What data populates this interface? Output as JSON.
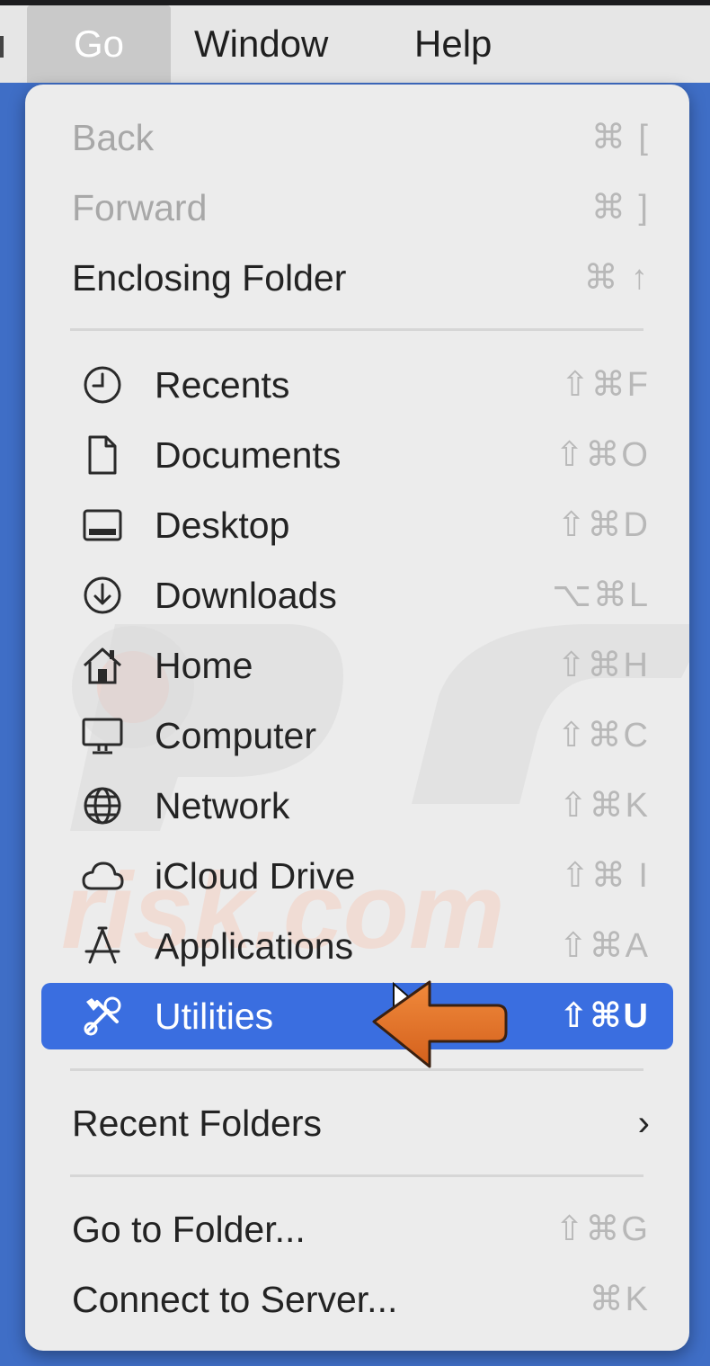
{
  "menubar": {
    "items": [
      {
        "label": "Go",
        "active": true
      },
      {
        "label": "Window",
        "active": false
      },
      {
        "label": "Help",
        "active": false
      }
    ]
  },
  "menu": {
    "nav_items": [
      {
        "label": "Back",
        "shortcut": "⌘ [",
        "enabled": false
      },
      {
        "label": "Forward",
        "shortcut": "⌘ ]",
        "enabled": false
      },
      {
        "label": "Enclosing Folder",
        "shortcut": "⌘ ↑",
        "enabled": true
      }
    ],
    "location_items": [
      {
        "label": "Recents",
        "shortcut": "⇧⌘F",
        "icon": "clock-icon"
      },
      {
        "label": "Documents",
        "shortcut": "⇧⌘O",
        "icon": "document-icon"
      },
      {
        "label": "Desktop",
        "shortcut": "⇧⌘D",
        "icon": "desktop-icon"
      },
      {
        "label": "Downloads",
        "shortcut": "⌥⌘L",
        "icon": "download-icon"
      },
      {
        "label": "Home",
        "shortcut": "⇧⌘H",
        "icon": "home-icon"
      },
      {
        "label": "Computer",
        "shortcut": "⇧⌘C",
        "icon": "computer-icon"
      },
      {
        "label": "Network",
        "shortcut": "⇧⌘K",
        "icon": "network-icon"
      },
      {
        "label": "iCloud Drive",
        "shortcut": "⇧⌘ I",
        "icon": "cloud-icon"
      },
      {
        "label": "Applications",
        "shortcut": "⇧⌘A",
        "icon": "applications-icon"
      },
      {
        "label": "Utilities",
        "shortcut": "⇧⌘U",
        "icon": "utilities-icon",
        "highlighted": true
      }
    ],
    "recent_folders": {
      "label": "Recent Folders",
      "submenu_indicator": "›"
    },
    "go_items": [
      {
        "label": "Go to Folder...",
        "shortcut": "⇧⌘G"
      },
      {
        "label": "Connect to Server...",
        "shortcut": "⌘K"
      }
    ]
  },
  "colors": {
    "highlight": "#3a6ee0",
    "background": "#3f6ec6",
    "menu_bg": "#ececec",
    "annotation_arrow": "#e8732a"
  }
}
